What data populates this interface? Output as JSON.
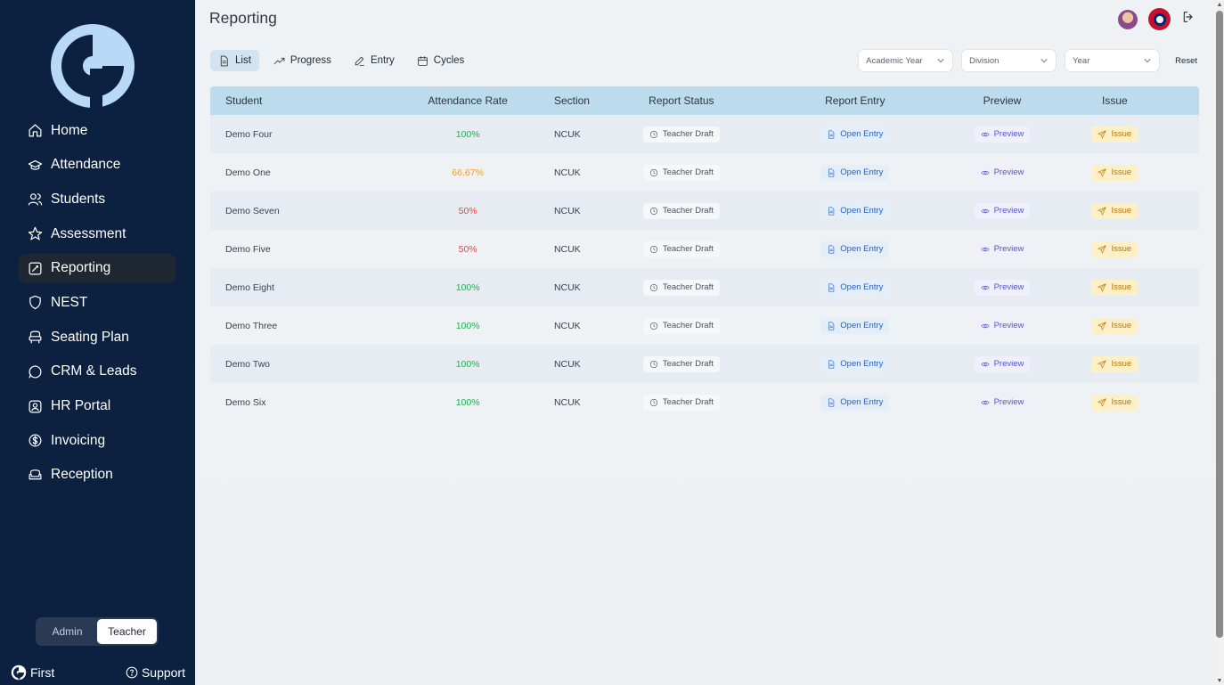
{
  "app": {
    "page_title": "Reporting"
  },
  "sidebar": {
    "items": [
      {
        "label": "Home",
        "icon": "home-icon",
        "active": false
      },
      {
        "label": "Attendance",
        "icon": "attendance-icon",
        "active": false
      },
      {
        "label": "Students",
        "icon": "students-icon",
        "active": false
      },
      {
        "label": "Assessment",
        "icon": "star-icon",
        "active": false
      },
      {
        "label": "Reporting",
        "icon": "reporting-icon",
        "active": true
      },
      {
        "label": "NEST",
        "icon": "shield-icon",
        "active": false
      },
      {
        "label": "Seating Plan",
        "icon": "seat-icon",
        "active": false
      },
      {
        "label": "CRM & Leads",
        "icon": "chat-icon",
        "active": false
      },
      {
        "label": "HR Portal",
        "icon": "person-badge-icon",
        "active": false
      },
      {
        "label": "Invoicing",
        "icon": "dollar-icon",
        "active": false
      },
      {
        "label": "Reception",
        "icon": "sofa-icon",
        "active": false
      }
    ],
    "role_toggle": {
      "admin": "Admin",
      "teacher": "Teacher",
      "selected": "Teacher"
    },
    "footer": {
      "brand": "First",
      "support": "Support"
    }
  },
  "tabs": [
    {
      "label": "List",
      "icon": "document-icon",
      "active": true
    },
    {
      "label": "Progress",
      "icon": "trending-up-icon",
      "active": false
    },
    {
      "label": "Entry",
      "icon": "pencil-icon",
      "active": false
    },
    {
      "label": "Cycles",
      "icon": "calendar-icon",
      "active": false
    }
  ],
  "filters": {
    "academic_year": "Academic Year",
    "division": "Division",
    "year": "Year",
    "reset": "Reset"
  },
  "table": {
    "headers": {
      "student": "Student",
      "attendance_rate": "Attendance Rate",
      "section": "Section",
      "report_status": "Report Status",
      "report_entry": "Report Entry",
      "preview": "Preview",
      "issue": "Issue"
    },
    "rows": [
      {
        "student": "Demo Four",
        "rate": "100%",
        "rate_color": "#1fb053",
        "section": "NCUK",
        "status": "Teacher Draft",
        "entry": "Open Entry",
        "preview": "Preview",
        "issue": "Issue"
      },
      {
        "student": "Demo One",
        "rate": "66.67%",
        "rate_color": "#f0a02c",
        "section": "NCUK",
        "status": "Teacher Draft",
        "entry": "Open Entry",
        "preview": "Preview",
        "issue": "Issue"
      },
      {
        "student": "Demo Seven",
        "rate": "50%",
        "rate_color": "#e8474b",
        "section": "NCUK",
        "status": "Teacher Draft",
        "entry": "Open Entry",
        "preview": "Preview",
        "issue": "Issue"
      },
      {
        "student": "Demo Five",
        "rate": "50%",
        "rate_color": "#e8474b",
        "section": "NCUK",
        "status": "Teacher Draft",
        "entry": "Open Entry",
        "preview": "Preview",
        "issue": "Issue"
      },
      {
        "student": "Demo Eight",
        "rate": "100%",
        "rate_color": "#1fb053",
        "section": "NCUK",
        "status": "Teacher Draft",
        "entry": "Open Entry",
        "preview": "Preview",
        "issue": "Issue"
      },
      {
        "student": "Demo Three",
        "rate": "100%",
        "rate_color": "#1fb053",
        "section": "NCUK",
        "status": "Teacher Draft",
        "entry": "Open Entry",
        "preview": "Preview",
        "issue": "Issue"
      },
      {
        "student": "Demo Two",
        "rate": "100%",
        "rate_color": "#1fb053",
        "section": "NCUK",
        "status": "Teacher Draft",
        "entry": "Open Entry",
        "preview": "Preview",
        "issue": "Issue"
      },
      {
        "student": "Demo Six",
        "rate": "100%",
        "rate_color": "#1fb053",
        "section": "NCUK",
        "status": "Teacher Draft",
        "entry": "Open Entry",
        "preview": "Preview",
        "issue": "Issue"
      }
    ]
  },
  "colors": {
    "sidebar_bg": "#0c2140",
    "active_nav_bg": "#1f2732",
    "header_row_bg": "#bcdbed",
    "accent_blue": "#245fc1"
  }
}
